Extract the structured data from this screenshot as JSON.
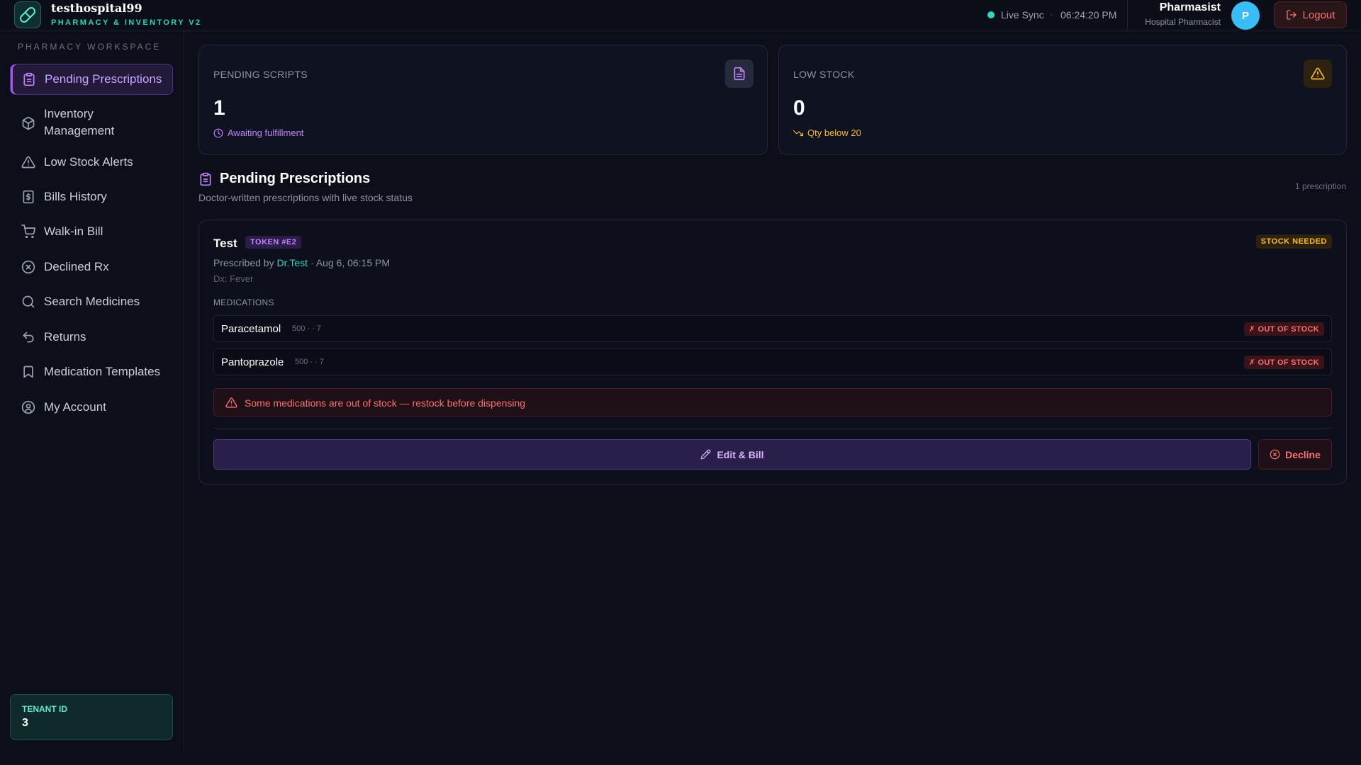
{
  "brand": {
    "name": "testhospital99",
    "subtitle": "PHARMACY & INVENTORY V2"
  },
  "header": {
    "sync_label": "Live Sync",
    "separator": "·",
    "time": "06:24:20 PM",
    "user_name": "Pharmasist",
    "user_role": "Hospital Pharmacist",
    "avatar_initial": "P",
    "logout_label": "Logout"
  },
  "sidebar": {
    "heading": "PHARMACY WORKSPACE",
    "items": [
      {
        "label": "Pending Prescriptions",
        "icon": "clipboard-icon",
        "active": true
      },
      {
        "label": "Inventory Management",
        "icon": "package-icon",
        "active": false
      },
      {
        "label": "Low Stock Alerts",
        "icon": "alert-triangle-icon",
        "active": false
      },
      {
        "label": "Bills History",
        "icon": "receipt-icon",
        "active": false
      },
      {
        "label": "Walk-in Bill",
        "icon": "cart-icon",
        "active": false
      },
      {
        "label": "Declined Rx",
        "icon": "x-circle-icon",
        "active": false
      },
      {
        "label": "Search Medicines",
        "icon": "search-icon",
        "active": false
      },
      {
        "label": "Returns",
        "icon": "undo-icon",
        "active": false
      },
      {
        "label": "Medication Templates",
        "icon": "bookmark-icon",
        "active": false
      },
      {
        "label": "My Account",
        "icon": "user-circle-icon",
        "active": false
      }
    ],
    "tenant": {
      "label": "TENANT ID",
      "value": "3"
    }
  },
  "stats": {
    "pending": {
      "title": "PENDING SCRIPTS",
      "value": "1",
      "note": "Awaiting fulfillment",
      "icon": "file-text-icon"
    },
    "low_stock": {
      "title": "LOW STOCK",
      "value": "0",
      "note": "Qty below 20",
      "icon": "alert-triangle-icon"
    }
  },
  "section": {
    "title": "Pending Prescriptions",
    "subtitle": "Doctor-written prescriptions with live stock status",
    "count": "1 prescription"
  },
  "prescription": {
    "patient": "Test",
    "token": "TOKEN #E2",
    "status": "STOCK NEEDED",
    "prescribed_by": "Prescribed by",
    "doctor": "Dr.Test",
    "date": "· Aug 6, 06:15 PM",
    "diagnosis": "Dx: Fever",
    "medications_label": "MEDICATIONS",
    "medications": [
      {
        "name": "Paracetamol",
        "dose": "500 · · 7",
        "status": "✗ OUT OF STOCK"
      },
      {
        "name": "Pantoprazole",
        "dose": "500 · · 7",
        "status": "✗ OUT OF STOCK"
      }
    ],
    "warning": "Some medications are out of stock — restock before dispensing",
    "bill_label": "Edit & Bill",
    "decline_label": "Decline"
  },
  "colors": {
    "accent": "#a855f7",
    "teal": "#2dd4bf",
    "danger": "#f87171",
    "warning": "#fbbf24",
    "background": "#0c0f19"
  }
}
